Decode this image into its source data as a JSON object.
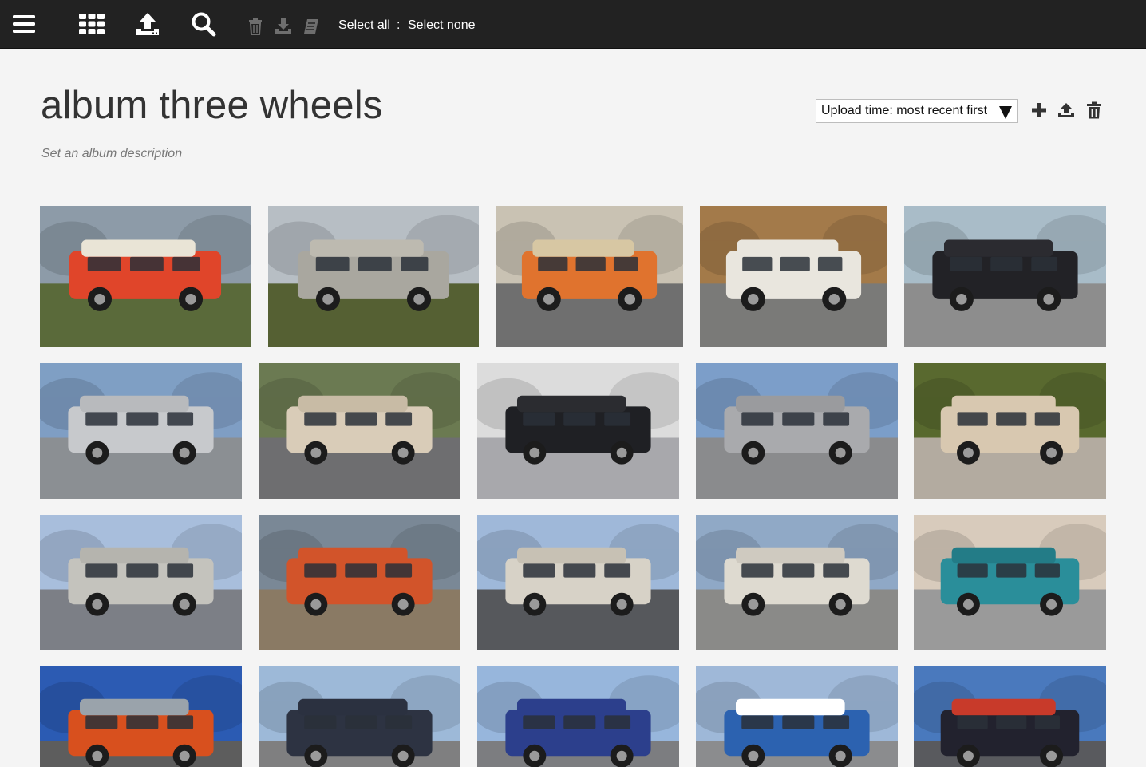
{
  "toolbar": {
    "menu_icon": "hamburger-menu-icon",
    "grid_icon": "grid-icon",
    "upload_icon": "upload-icon",
    "search_icon": "search-icon",
    "delete_icon": "trash-icon",
    "download_icon": "download-icon",
    "album_icon": "add-to-album-icon",
    "select_all": "Select all",
    "separator": ":",
    "select_none": "Select none"
  },
  "album": {
    "title": "album three wheels",
    "description_placeholder": "Set an album description",
    "sort": {
      "selected": "Upload time: most recent first"
    },
    "actions": {
      "add_icon": "plus-icon",
      "upload_icon": "upload-icon",
      "delete_icon": "trash-icon"
    }
  },
  "colors": {
    "topbar": "#222222",
    "page_bg": "#f4f4f4",
    "title": "#333333",
    "description": "#777777"
  },
  "photos": [
    {
      "subject": "red camper van",
      "sky": "#8d9ba8",
      "ground": "#5a6a3a",
      "body": "#e0452a",
      "roof": "#e9e4d6"
    },
    {
      "subject": "grey food truck",
      "sky": "#b7bec4",
      "ground": "#556033",
      "body": "#a9a79f",
      "roof": "#bdbab0"
    },
    {
      "subject": "orange vw van",
      "sky": "#c9c2b3",
      "ground": "#6f6f6f",
      "body": "#e0732e",
      "roof": "#d7c7a3"
    },
    {
      "subject": "white motorhome",
      "sky": "#a37a4a",
      "ground": "#7a7a78",
      "body": "#e9e6de",
      "roof": "#e9e6de"
    },
    {
      "subject": "black small car",
      "sky": "#a9bcc8",
      "ground": "#8d8d8d",
      "body": "#222226",
      "roof": "#2b2b30"
    },
    {
      "subject": "silver suv",
      "sky": "#7f9fc4",
      "ground": "#8b8f93",
      "body": "#c7c9cc",
      "roof": "#b8babd"
    },
    {
      "subject": "beige buggy",
      "sky": "#6b7a52",
      "ground": "#6e6e70",
      "body": "#d9ccb8",
      "roof": "#c8bba5"
    },
    {
      "subject": "black pickup",
      "sky": "#dcdcdc",
      "ground": "#a8a8ac",
      "body": "#1f2024",
      "roof": "#2b2c30"
    },
    {
      "subject": "silver rav4",
      "sky": "#7c9ec9",
      "ground": "#8a8b8d",
      "body": "#a9aaad",
      "roof": "#9a9b9e"
    },
    {
      "subject": "beige utility van",
      "sky": "#59692f",
      "ground": "#b3aba0",
      "body": "#d8c8b0",
      "roof": "#d8c8b0"
    },
    {
      "subject": "silver station wagon",
      "sky": "#a8bedc",
      "ground": "#7c7f86",
      "body": "#c4c3bd",
      "roof": "#b5b4ae"
    },
    {
      "subject": "orange tractor",
      "sky": "#7a8896",
      "ground": "#8a7a64",
      "body": "#d2542a",
      "roof": "#d2542a"
    },
    {
      "subject": "white caravan",
      "sky": "#9fb8d9",
      "ground": "#56585c",
      "body": "#d7d2c7",
      "roof": "#c7c1b4"
    },
    {
      "subject": "white land rover",
      "sky": "#90a9c6",
      "ground": "#8a8a88",
      "body": "#dedad0",
      "roof": "#cfcac0"
    },
    {
      "subject": "teal minivan",
      "sky": "#d8cbbc",
      "ground": "#9a9a9a",
      "body": "#2a8e9a",
      "roof": "#237c87"
    },
    {
      "subject": "orange crane truck",
      "sky": "#2c5bb3",
      "ground": "#5d5d5d",
      "body": "#d8501e",
      "roof": "#9aa3ab"
    },
    {
      "subject": "dark suv",
      "sky": "#9db9d8",
      "ground": "#7f7f80",
      "body": "#2d3342",
      "roof": "#2b3140"
    },
    {
      "subject": "blue pickup",
      "sky": "#97b6dc",
      "ground": "#7c7d80",
      "body": "#2c3f8c",
      "roof": "#2c3f8c"
    },
    {
      "subject": "blue mini",
      "sky": "#9fb8d8",
      "ground": "#8b8c8e",
      "body": "#2c62b0",
      "roof": "#ffffff"
    },
    {
      "subject": "dark minivan with kayak",
      "sky": "#4a79bd",
      "ground": "#595a5e",
      "body": "#22222e",
      "roof": "#c83a2a"
    }
  ]
}
